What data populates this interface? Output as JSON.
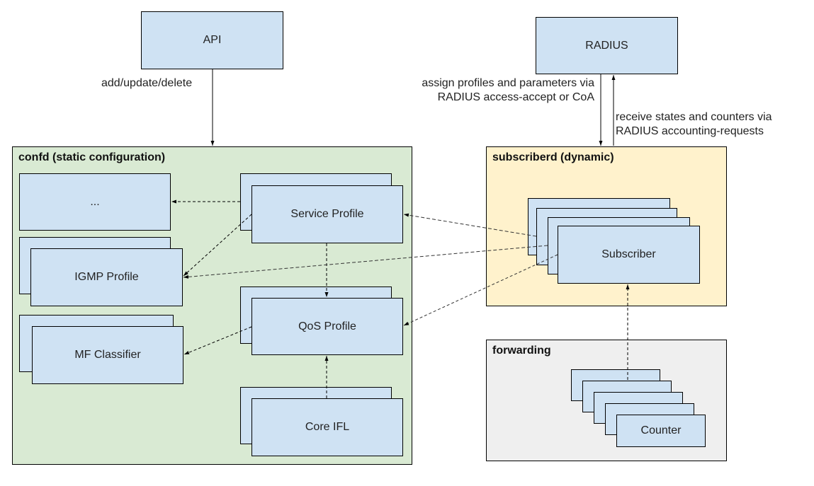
{
  "external": {
    "api": {
      "label": "API"
    },
    "radius": {
      "label": "RADIUS"
    }
  },
  "edge_labels": {
    "api_to_confd": "add/update/delete",
    "radius_to_subscriberd_line1": "assign profiles and parameters via",
    "radius_to_subscriberd_line2": "RADIUS access-accept or CoA",
    "subscriberd_to_radius_line1": "receive states and counters via",
    "subscriberd_to_radius_line2": "RADIUS accounting-requests"
  },
  "containers": {
    "confd": {
      "title": "confd (static configuration)",
      "color": "#d9ead3",
      "nodes": {
        "other": "...",
        "igmp_profile": "IGMP Profile",
        "mf_classifier": "MF Classifier",
        "service_profile": "Service Profile",
        "qos_profile": "QoS Profile",
        "core_ifl": "Core IFL"
      }
    },
    "subscriberd": {
      "title": "subscriberd (dynamic)",
      "color": "#fff2cc",
      "nodes": {
        "subscriber": "Subscriber"
      }
    },
    "forwarding": {
      "title": "forwarding",
      "color": "#efefef",
      "nodes": {
        "counter": "Counter"
      }
    }
  },
  "node_color": "#cfe2f3",
  "edges": [
    {
      "from": "API",
      "to": "confd",
      "style": "solid"
    },
    {
      "from": "RADIUS",
      "to": "subscriberd",
      "style": "solid"
    },
    {
      "from": "subscriberd",
      "to": "RADIUS",
      "style": "solid"
    },
    {
      "from": "Service Profile",
      "to": "...",
      "style": "dashed"
    },
    {
      "from": "Service Profile",
      "to": "IGMP Profile",
      "style": "dashed"
    },
    {
      "from": "Service Profile",
      "to": "QoS Profile",
      "style": "dashed"
    },
    {
      "from": "Core IFL",
      "to": "QoS Profile",
      "style": "dashed"
    },
    {
      "from": "QoS Profile",
      "to": "MF Classifier",
      "style": "dashed"
    },
    {
      "from": "Subscriber",
      "to": "Service Profile",
      "style": "dashed"
    },
    {
      "from": "Subscriber",
      "to": "IGMP Profile",
      "style": "dashed"
    },
    {
      "from": "Subscriber",
      "to": "QoS Profile",
      "style": "dashed"
    },
    {
      "from": "Counter",
      "to": "Subscriber",
      "style": "dashed"
    }
  ]
}
